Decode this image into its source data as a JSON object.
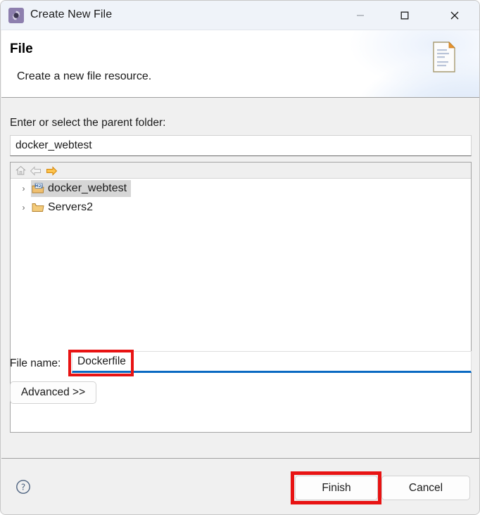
{
  "window": {
    "title": "Create New File",
    "icon": "wizard-gear-icon",
    "controls": {
      "minimize": "—",
      "maximize": "□",
      "close": "✕"
    }
  },
  "header": {
    "title": "File",
    "description": "Create a new file resource.",
    "icon": "new-file-document-icon"
  },
  "form": {
    "parent_folder_label": "Enter or select the parent folder:",
    "parent_folder_value": "docker_webtest",
    "file_name_label": "File name:",
    "file_name_value": "Dockerfile",
    "advanced_label": "Advanced >>"
  },
  "tree": {
    "toolbar": [
      {
        "name": "home-icon",
        "enabled": false
      },
      {
        "name": "back-arrow-icon",
        "enabled": false
      },
      {
        "name": "forward-arrow-icon",
        "enabled": true
      }
    ],
    "items": [
      {
        "label": "docker_webtest",
        "icon": "maven-project-folder-icon",
        "selected": true,
        "expandable": true
      },
      {
        "label": "Servers2",
        "icon": "folder-icon",
        "selected": false,
        "expandable": true
      }
    ],
    "expand_arrow": "›"
  },
  "footer": {
    "help_label": "?",
    "finish_label": "Finish",
    "cancel_label": "Cancel"
  },
  "annotations": {
    "highlight_color": "#e81313",
    "targets": [
      "file-name-value",
      "finish-button"
    ]
  },
  "colors": {
    "titlebar_bg": "#eff3f9",
    "dialog_bg": "#f0f0f0",
    "focus_underline": "#0a69c2",
    "selection_bg": "#d6d6d6",
    "wizard_icon_purple": "#8d7fae"
  }
}
